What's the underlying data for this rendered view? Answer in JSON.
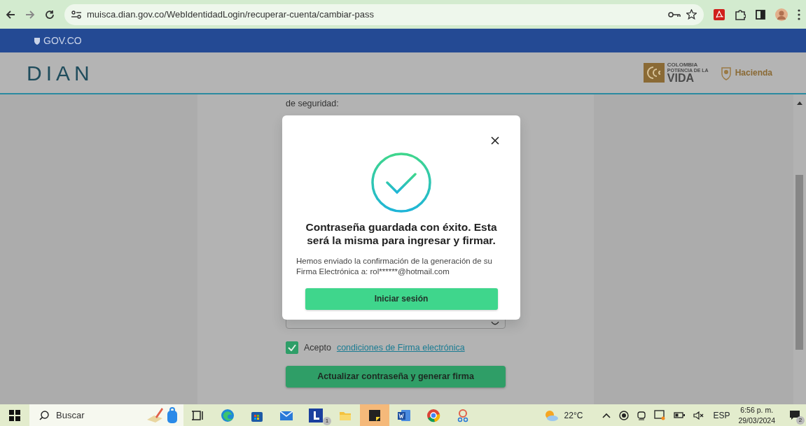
{
  "browser": {
    "url": "muisca.dian.gov.co/WebIdentidadLogin/recuperar-cuenta/cambiar-pass"
  },
  "gov_bar": {
    "label": "GOV.CO"
  },
  "header": {
    "logo": "DIAN",
    "partner_logos": [
      {
        "kind": "colombia",
        "lines": [
          "COLOMBIA",
          "POTENCIA DE LA",
          "VIDA"
        ]
      },
      {
        "kind": "hacienda",
        "lines": [
          "Hacienda"
        ]
      }
    ]
  },
  "form": {
    "intro": "de seguridad:",
    "terms": {
      "checked": true,
      "prefix": "Acepto",
      "link": "condiciones de Firma electrónica"
    },
    "submit": "Actualizar contraseña y generar firma"
  },
  "modal": {
    "title": "Contraseña guardada con éxito. Esta será la misma para ingresar y firmar.",
    "message": "Hemos enviado la confirmación de la generación de su Firma Electrónica a: rol******@hotmail.com",
    "button": "Iniciar sesión"
  },
  "taskbar": {
    "search_placeholder": "Buscar",
    "app_badge": "1",
    "weather": "22°C",
    "language": "ESP",
    "time": "6:56 p. m.",
    "date": "29/03/2024",
    "notifications": "2"
  }
}
